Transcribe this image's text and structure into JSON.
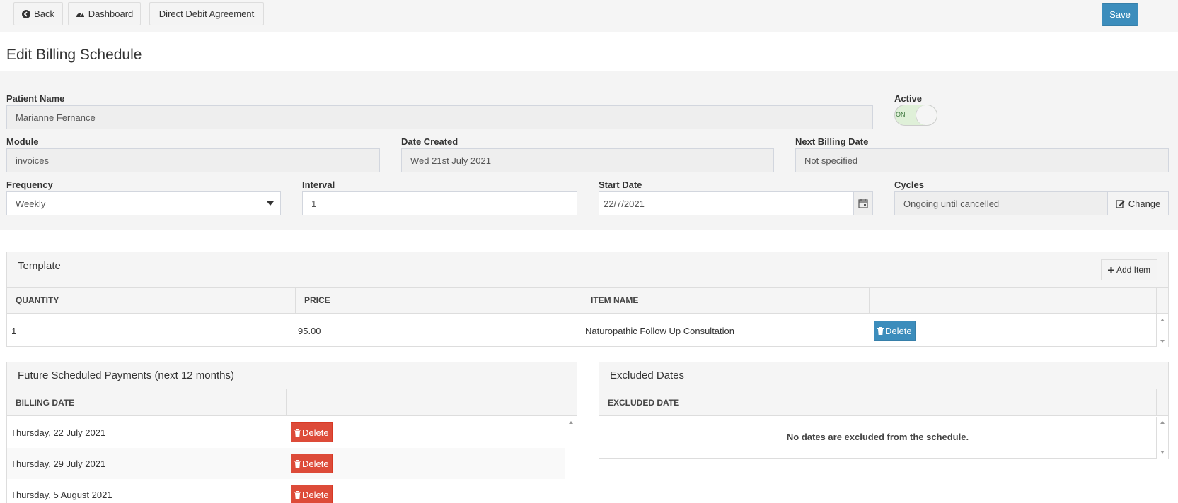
{
  "toolbar": {
    "back_label": "Back",
    "dashboard_label": "Dashboard",
    "direct_debit_label": "Direct Debit Agreement",
    "save_label": "Save",
    "accent": "#3c8dbc"
  },
  "page": {
    "title": "Edit Billing Schedule"
  },
  "form": {
    "patient_name": {
      "label": "Patient Name",
      "value": "Marianne Fernance"
    },
    "active": {
      "label": "Active",
      "state_text": "ON",
      "on": true
    },
    "module": {
      "label": "Module",
      "value": "invoices"
    },
    "date_created": {
      "label": "Date Created",
      "value": "Wed 21st July 2021"
    },
    "next_billing_date": {
      "label": "Next Billing Date",
      "value": "Not specified"
    },
    "frequency": {
      "label": "Frequency",
      "value": "Weekly"
    },
    "interval": {
      "label": "Interval",
      "value": "1"
    },
    "start_date": {
      "label": "Start Date",
      "value": "22/7/2021"
    },
    "cycles": {
      "label": "Cycles",
      "value": "Ongoing until cancelled",
      "change_label": "Change"
    }
  },
  "template": {
    "title": "Template",
    "add_item_label": "Add Item",
    "columns": [
      "QUANTITY",
      "PRICE",
      "ITEM NAME"
    ],
    "rows": [
      {
        "quantity": "1",
        "price": "95.00",
        "item_name": "Naturopathic Follow Up Consultation",
        "delete_label": "Delete"
      }
    ]
  },
  "future_payments": {
    "title": "Future Scheduled Payments (next 12 months)",
    "columns": [
      "BILLING DATE"
    ],
    "rows": [
      {
        "date": "Thursday, 22 July 2021",
        "delete_label": "Delete"
      },
      {
        "date": "Thursday, 29 July 2021",
        "delete_label": "Delete"
      },
      {
        "date": "Thursday, 5 August 2021",
        "delete_label": "Delete"
      }
    ]
  },
  "excluded_dates": {
    "title": "Excluded Dates",
    "columns": [
      "EXCLUDED DATE"
    ],
    "empty_message": "No dates are excluded from the schedule."
  }
}
